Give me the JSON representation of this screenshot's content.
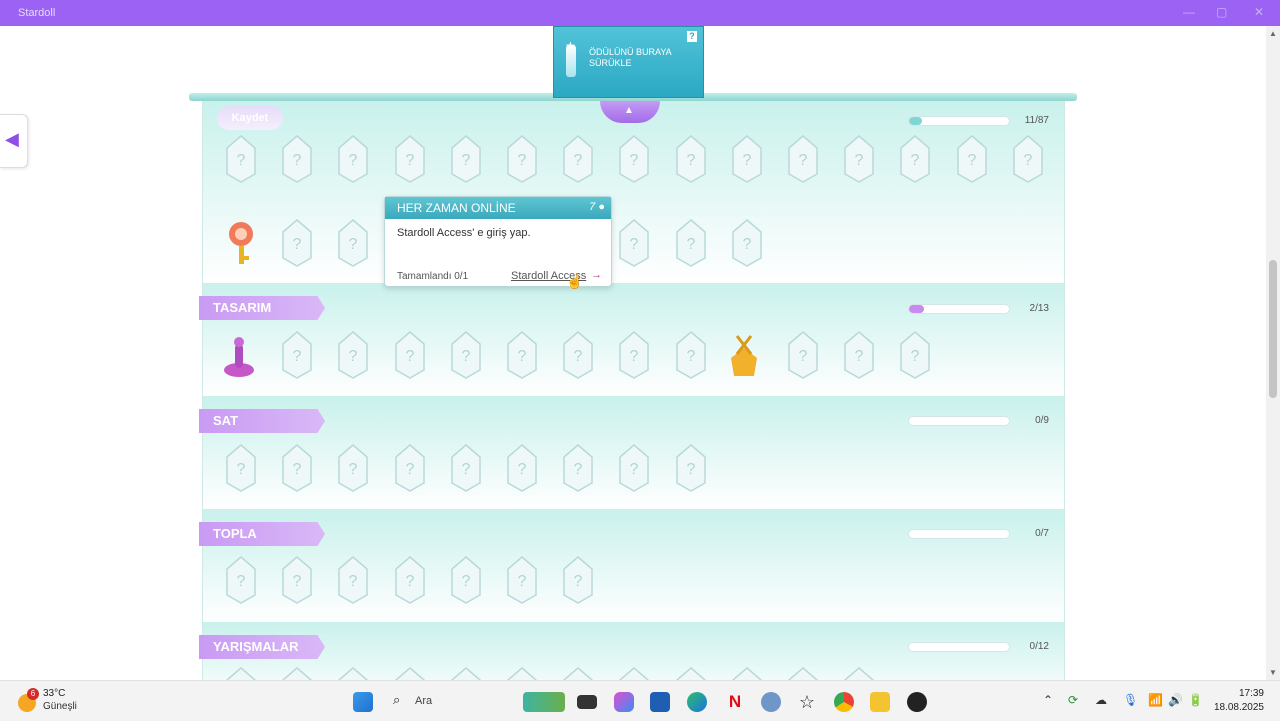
{
  "window": {
    "title": "Stardoll",
    "minimize": "—",
    "maximize": "▢",
    "close": "✕"
  },
  "back_icon": "megaphone-back-icon",
  "dropzone": {
    "text": "ÖDÜLÜNÜ BURAYA SÜRÜKLE",
    "help": "?"
  },
  "save_label": "Kaydet",
  "top_section": {
    "count": "11/87",
    "progress": 0.13,
    "color": "#7fd6d6"
  },
  "tooltip": {
    "title": "HER ZAMAN ONLİNE",
    "points": "7",
    "description": "Stardoll Access' e giriş yap.",
    "completed": "Tamamlandı 0/1",
    "link": "Stardoll Access",
    "link_arrow": "→"
  },
  "sections": [
    {
      "label": "TASARIM",
      "count": "2/13",
      "progress": 0.15,
      "color": "#c68af0"
    },
    {
      "label": "SAT",
      "count": "0/9",
      "progress": 0
    },
    {
      "label": "TOPLA",
      "count": "0/7",
      "progress": 0
    },
    {
      "label": "YARIŞMALAR",
      "count": "0/12",
      "progress": 0
    }
  ],
  "taskbar": {
    "weather_badge": "6",
    "temperature": "33°C",
    "condition": "Güneşli",
    "search_placeholder": "Ara",
    "time": "17:39",
    "date": "18.08.2025"
  },
  "colors": {
    "accent": "#9b62f3",
    "teal": "#c9f1ec",
    "purple_tab": "#c99af3"
  }
}
